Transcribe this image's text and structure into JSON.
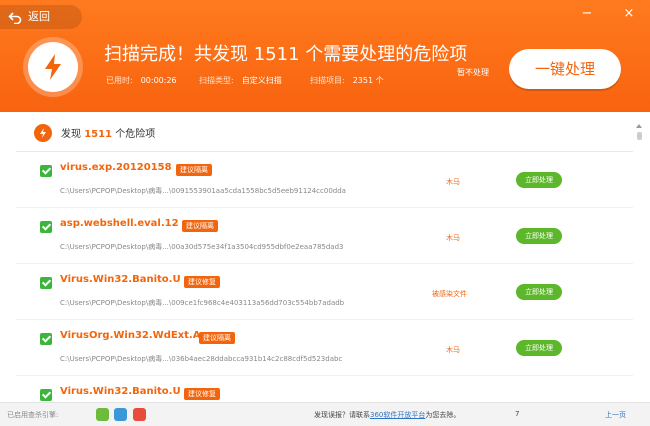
{
  "header": {
    "back_label": "返回",
    "title": "扫描完成！共发现  1511  个需要处理的危险项",
    "stats": [
      {
        "label": "已用时:",
        "value": "00:00:26"
      },
      {
        "label": "扫描类型:",
        "value": "自定义扫描"
      },
      {
        "label": "扫描项目:",
        "value": "2351 个"
      }
    ],
    "no_handle_label": "暂不处理",
    "fix_all_label": "一键处理"
  },
  "summary": {
    "prefix": "发现",
    "count": "1511",
    "suffix": "个危险项"
  },
  "threats": [
    {
      "name": "virus.exp.20120158",
      "tag": "建议隔离",
      "path": "C:\\Users\\PCPOP\\Desktop\\病毒...\\0091553901aa5cda1558bc5d5eeb91124cc00dda",
      "type": "木马",
      "action": "立即处理"
    },
    {
      "name": "asp.webshell.eval.12",
      "tag": "建议隔离",
      "path": "C:\\Users\\PCPOP\\Desktop\\病毒...\\00a30d575e34f1a3504cd955dbf0e2eaa785dad3",
      "type": "木马",
      "action": "立即处理"
    },
    {
      "name": "Virus.Win32.Banito.U",
      "tag": "建议修复",
      "path": "C:\\Users\\PCPOP\\Desktop\\病毒...\\009ce1fc968c4e403113a56dd703c554bb7adadb",
      "type": "被感染文件",
      "action": "立即处理"
    },
    {
      "name": "VirusOrg.Win32.WdExt.A",
      "tag": "建议隔离",
      "path": "C:\\Users\\PCPOP\\Desktop\\病毒...\\036b4aec28ddabcca931b14c2c88cdf5d523dabc",
      "type": "木马",
      "action": "立即处理"
    },
    {
      "name": "Virus.Win32.Banito.U",
      "tag": "建议修复"
    }
  ],
  "footer": {
    "engines_label": "已启用查杀引擎:",
    "notice_prefix": "发现误报？请联系",
    "notice_link": "360软件开放平台",
    "notice_suffix": "为您去除。",
    "more": "7",
    "prev_page": "上一页"
  },
  "colors": {
    "accent": "#f2650c",
    "fix_button": "#5cb82a",
    "link": "#2f73c4"
  }
}
